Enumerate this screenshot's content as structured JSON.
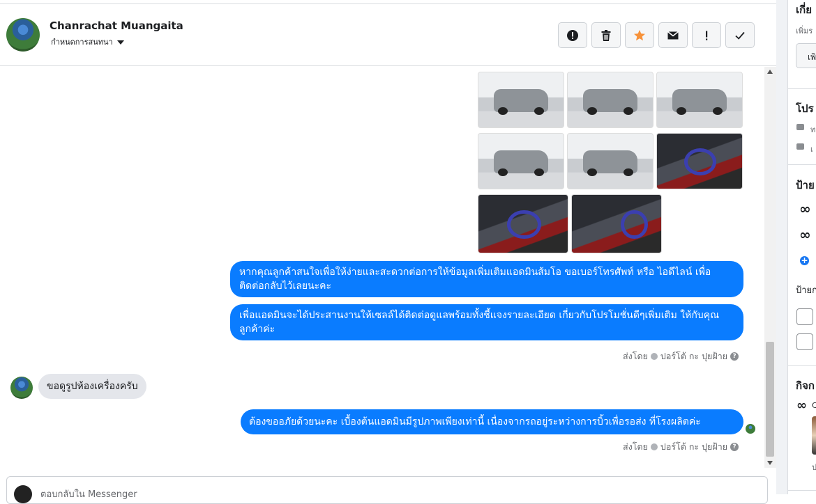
{
  "header": {
    "contact_name": "Chanrachat Muangaita",
    "assign_label": "กำหนดการสนทนา",
    "actions": [
      {
        "name": "report-button",
        "icon": "exclamation-circle-icon"
      },
      {
        "name": "delete-button",
        "icon": "trash-icon"
      },
      {
        "name": "star-button",
        "icon": "star-icon",
        "color": "#f7923a"
      },
      {
        "name": "mark-unread-button",
        "icon": "envelope-icon"
      },
      {
        "name": "follow-up-button",
        "icon": "exclamation-icon"
      },
      {
        "name": "mark-done-button",
        "icon": "check-icon"
      }
    ]
  },
  "messages": {
    "out1": "หากคุณลูกค้าสนใจเพื่อให้ง่ายและสะดวกต่อการให้ข้อมูลเพิ่มเติมแอดมินส้มโอ ขอเบอร์โทรศัพท์ หรือ ไอดีไลน์ เพื่อติดต่อกลับไว้เลยนะคะ",
    "out2": "เพื่อแอดมินจะได้ประสานงานให้เซลล์ได้ติดต่อดูแลพร้อมทั้งชี้แจงรายละเอียด เกี่ยวกับโปรโมชั่นดีๆเพิ่มเติม ให้กับคุณลูกค้าค่ะ",
    "sent_by_1": "ส่งโดย",
    "sent_name_1": "ปอร์โต้ กะ ปุยฝ้าย",
    "in1": "ขอดูรูปห้องเครื่องครับ",
    "out3": "ต้องขออภัยด้วยนะคะ เบื้องต้นแอดมินมีรูปภาพเพียงเท่านี้ เนื่องจากรถอยู่ระหว่างการบิ้วเพื่อรอส่ง ที่โรงผลิตค่ะ",
    "sent_by_2": "ส่งโดย",
    "sent_name_2": "ปอร์โต้ กะ ปุยฝ้าย"
  },
  "composer": {
    "placeholder": "ตอบกลับใน Messenger"
  },
  "right_panel": {
    "heading1": "เกี่ย",
    "sub1": "เพิ่มร",
    "box1": "เพิ",
    "heading2": "โปร",
    "item2a": "ท",
    "item2b": "เ",
    "heading3": "ป้าย",
    "label3": "ป้ายก",
    "heading4": "กิจก",
    "item4": "C",
    "item4b": "ป"
  },
  "colors": {
    "outgoing_bubble": "#0a7cff",
    "incoming_bubble": "#e4e6eb",
    "accent_star": "#f7923a"
  }
}
